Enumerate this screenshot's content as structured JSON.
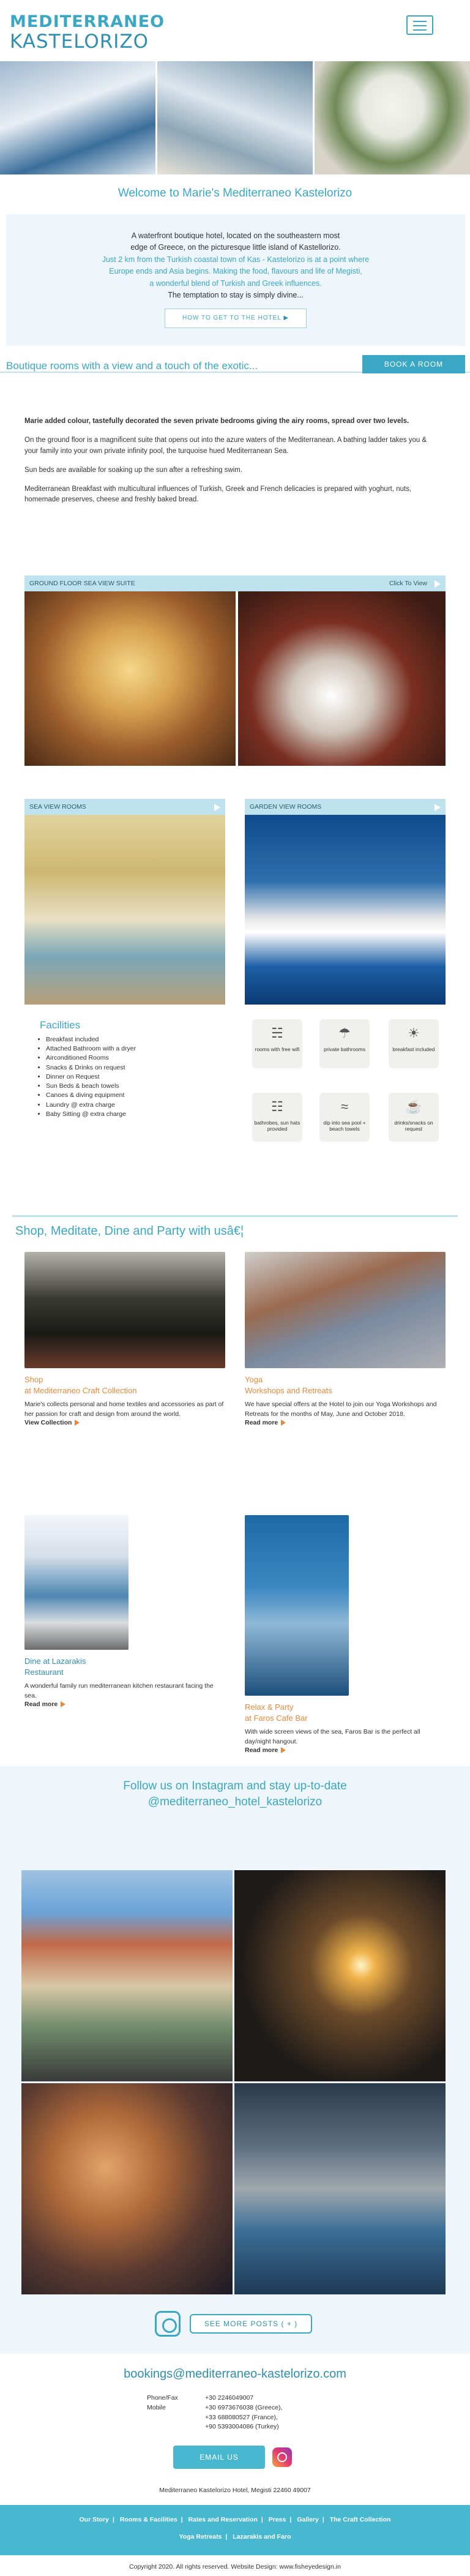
{
  "brand": {
    "line1": "MEDITERRANEO",
    "line2": "KASTELORIZO"
  },
  "welcome": "Welcome to Marie's Mediterraneo Kastelorizo",
  "intro": {
    "lines_dark": [
      "A waterfront boutique hotel, located on the southeastern most",
      "edge of Greece, on the picturesque little island of Kastellorizo."
    ],
    "lines_blue": [
      "Just 2 km from the Turkish coastal town of Kas - Kastelorizo is at a point where",
      "Europe ends and Asia begins. Making the food, flavours and life of Megisti,",
      "a wonderful blend of Turkish and Greek influences."
    ],
    "last": "The temptation to stay is simply divine...",
    "button": "HOW TO GET TO THE HOTEL"
  },
  "rooms_band": {
    "title": "Boutique rooms with a view and a touch of the exotic...",
    "book": "BOOK A ROOM"
  },
  "description": [
    "Marie added colour, tastefully decorated the seven private bedrooms giving the airy rooms, spread over two levels.",
    "On the ground floor is a magnificent suite that opens out into the azure waters of the Mediterranean. A bathing ladder takes you & your family into your own private infinity pool, the turquoise hued Mediterranean Sea.",
    "Sun beds are available for soaking up the sun after a refreshing swim.",
    "Mediterranean Breakfast with multicultural influences of Turkish, Greek and French delicacies is prepared with yoghurt, nuts, homemade preserves, cheese and freshly baked bread."
  ],
  "suites": {
    "ground": {
      "title": "GROUND FLOOR SEA VIEW SUITE",
      "cta": "Click To View"
    },
    "sea": {
      "title": "SEA VIEW ROOMS"
    },
    "garden": {
      "title": "GARDEN VIEW ROOMS"
    }
  },
  "facilities": {
    "title": "Facilities",
    "items": [
      "Breakfast included",
      "Attached Bathroom with a dryer",
      "Airconditioned Rooms",
      "Snacks & Drinks on request",
      "Dinner on Request",
      "Sun Beds & beach towels",
      "Canoes & diving equipment",
      "Laundry @ extra charge",
      "Baby Sitting @ extra charge"
    ],
    "amenities": [
      {
        "icon": "wifi-icon",
        "label": "rooms with free wifi"
      },
      {
        "icon": "shower-icon",
        "label": "private bathrooms"
      },
      {
        "icon": "breakfast-icon",
        "label": "breakfast included"
      },
      {
        "icon": "bathrobe-icon",
        "label": "bathrobes, sun hats provided"
      },
      {
        "icon": "pool-icon",
        "label": "dip into sea pool + beach towels"
      },
      {
        "icon": "drinks-icon",
        "label": "drinks/snacks on request"
      }
    ]
  },
  "shop_title": "Shop, Meditate, Dine and Party with usâ€¦",
  "tiles": [
    {
      "cat1": "Shop",
      "cat2": "at Mediterraneo Craft Collection",
      "text": "Marie's collects personal and home textiles and accessories as part of her passion for craft and design from around the world.",
      "more": "View Collection"
    },
    {
      "cat1": "Yoga",
      "cat2": "Workshops and Retreats",
      "text": "We have special offers at the Hotel to join our Yoga Workshops and Retreats for the months of May, June and October 2018.",
      "more": "Read more"
    },
    {
      "cat1": "Dine at Lazarakis",
      "cat2": "Restaurant",
      "text": "A wonderful family run mediterranean kitchen restaurant facing the sea.",
      "more": "Read more"
    },
    {
      "cat1": "Relax & Party",
      "cat2": "at Faros Cafe Bar",
      "text": "With wide screen views of the sea, Faros Bar is the perfect all day/night hangout.",
      "more": "Read more"
    }
  ],
  "instagram": {
    "title1": "Follow us on Instagram and stay up-to-date",
    "title2": "@mediterraneo_hotel_kastelorizo",
    "more": "SEE MORE POSTS ( + )"
  },
  "contact": {
    "email": "bookings@mediterraneo-kastelorizo.com",
    "label1": "Phone/Fax",
    "label2": "Mobile",
    "phones": [
      "+30 2246049007",
      "+30 6973676038 (Greece),",
      "+33 688080527 (France),",
      "+90 5393004086 (Turkey)"
    ],
    "email_btn": "EMAIL US",
    "address": "Mediterraneo Kastelorizo Hotel, Megisti 22460 49007"
  },
  "footer": {
    "row1": [
      "Our Story",
      "Rooms & Facilities",
      "Rates and Reservation",
      "Press",
      "Gallery",
      "The Craft Collection"
    ],
    "row2": [
      "Yoga Retreats",
      "Lazarakis and Faro"
    ],
    "copyright": "Copyright 2020. All rights reserved. Website Design: www.fisheyedesign.in"
  }
}
